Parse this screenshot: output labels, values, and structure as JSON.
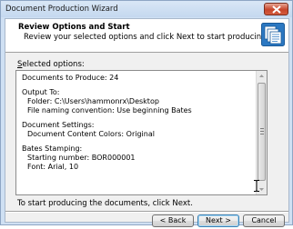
{
  "window": {
    "title": "Document Production Wizard"
  },
  "header": {
    "title": "Review Options and Start",
    "subtitle": "Review your selected options and click Next to start producing.",
    "icon": "documents-stack-icon"
  },
  "selected_options": {
    "label_prefix": "",
    "label_accel": "S",
    "label_rest": "elected options:",
    "lines": [
      {
        "text": "Documents to Produce: 24",
        "indent": false
      },
      {
        "blank": true
      },
      {
        "text": "Output To:",
        "indent": false
      },
      {
        "text": "Folder: C:\\Users\\hammonrx\\Desktop",
        "indent": true
      },
      {
        "text": "File naming convention: Use beginning Bates",
        "indent": true
      },
      {
        "blank": true
      },
      {
        "text": "Document Settings:",
        "indent": false
      },
      {
        "text": "Document Content Colors: Original",
        "indent": true
      },
      {
        "blank": true
      },
      {
        "text": "Bates Stamping:",
        "indent": false
      },
      {
        "text": "Starting number: BOR000001",
        "indent": true
      },
      {
        "text": "Font: Arial, 10",
        "indent": true
      }
    ]
  },
  "footer": {
    "instruction": "To start producing the documents, click Next."
  },
  "buttons": {
    "back": "< Back",
    "next": "Next >",
    "cancel": "Cancel"
  },
  "colors": {
    "window_frame": "#cfe0f3",
    "close_button": "#c7452b",
    "default_button_border": "#3c7fb1"
  }
}
